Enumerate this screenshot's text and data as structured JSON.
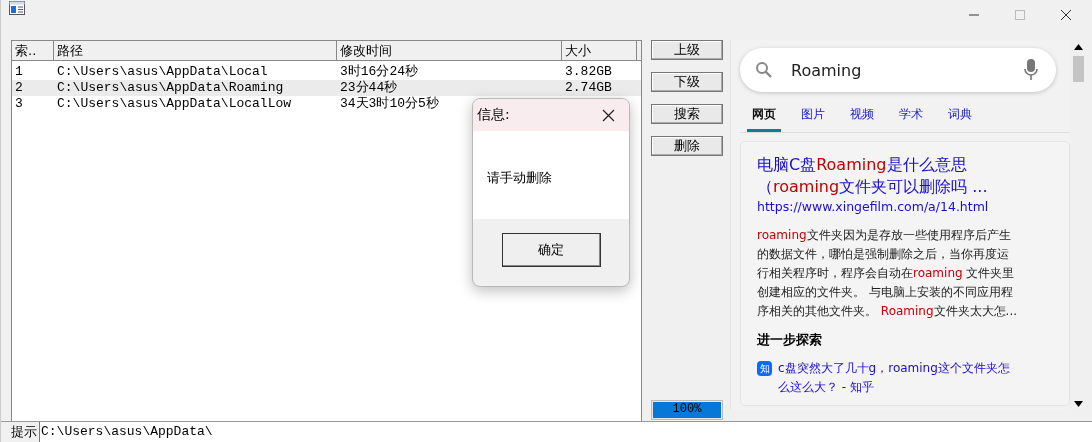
{
  "table": {
    "columns": [
      "索..",
      "路径",
      "修改时间",
      "大小"
    ],
    "rows": [
      {
        "cells": [
          "1",
          "C:\\Users\\asus\\AppData\\Local",
          "3时16分24秒",
          "3.82GB"
        ],
        "selected": false
      },
      {
        "cells": [
          "2",
          "C:\\Users\\asus\\AppData\\Roaming",
          "23分44秒",
          "2.74GB"
        ],
        "selected": true
      },
      {
        "cells": [
          "3",
          "C:\\Users\\asus\\AppData\\LocalLow",
          "34天3时10分5秒",
          ""
        ],
        "selected": false
      }
    ]
  },
  "buttons": [
    "上级",
    "下级",
    "搜索",
    "删除"
  ],
  "progress": {
    "level": 1,
    "reading": "100%"
  },
  "browser": {
    "search": {
      "value": "Roaming"
    },
    "tabs": [
      {
        "label": "网页",
        "selected": true
      },
      {
        "label": "图片",
        "selected": false
      },
      {
        "label": "视频",
        "selected": false
      },
      {
        "label": "学术",
        "selected": false
      },
      {
        "label": "词典",
        "selected": false
      }
    ],
    "result": {
      "title": [
        {
          "text": "电脑C盘",
          "highlight": false
        },
        {
          "text": "Roaming",
          "highlight": true
        },
        {
          "text": "是什么意思（",
          "highlight": false
        },
        {
          "text": "roaming",
          "highlight": true
        },
        {
          "text": "文件夹可以删除吗 ...",
          "highlight": false
        }
      ],
      "url": "https://www.xingefilm.com/a/14.html",
      "snippet": [
        {
          "text": "roaming",
          "highlight": true
        },
        {
          "text": "文件夹因为是存放一些使用程序后产生的数据文件，哪怕是强制删除之后，当你再度运行相关程序时，程序会自动在",
          "highlight": false
        },
        {
          "text": "roaming",
          "highlight": true
        },
        {
          "text": " 文件夹里创建相应的文件夹。 与电脑上安装的不同应用程序相关的其他文件夹。 ",
          "highlight": false
        },
        {
          "text": "Roaming",
          "highlight": true
        },
        {
          "text": "文件夹太大怎...",
          "highlight": false
        }
      ],
      "explore_heading": "进一步探索",
      "related": [
        {
          "badge": "知",
          "text": "c盘突然大了几十g，roaming这个文件夹怎么这么大？ - 知乎"
        }
      ]
    }
  },
  "status": {
    "label": "提示",
    "value": "C:\\Users\\asus\\AppData\\"
  },
  "dialog": {
    "title": "信息:",
    "message": "请手动删除",
    "button": "确定"
  }
}
